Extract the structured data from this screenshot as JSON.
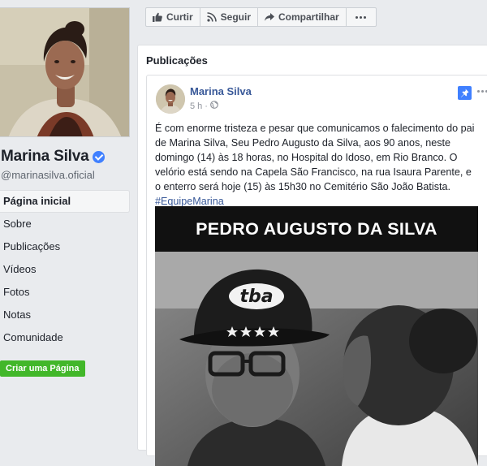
{
  "profile": {
    "name": "Marina Silva",
    "handle": "@marinasilva.oficial"
  },
  "nav": {
    "items": [
      {
        "label": "Página inicial",
        "active": true
      },
      {
        "label": "Sobre"
      },
      {
        "label": "Publicações"
      },
      {
        "label": "Vídeos"
      },
      {
        "label": "Fotos"
      },
      {
        "label": "Notas"
      },
      {
        "label": "Comunidade"
      }
    ],
    "create_page": "Criar uma Página"
  },
  "actions": {
    "like": "Curtir",
    "follow": "Seguir",
    "share": "Compartilhar"
  },
  "posts": {
    "section_title": "Publicações",
    "post": {
      "author": "Marina Silva",
      "time": "5 h",
      "separator": "·",
      "text": "É com enorme tristeza e pesar que comunicamos o falecimento do pai de Marina Silva, Seu Pedro Augusto da Silva, aos 90 anos, neste domingo (14) às 18 horas, no Hospital do Idoso, em Rio Branco. O velório está sendo na Capela São Francisco, na rua Isaura Parente, e o enterro será hoje (15) às 15h30 no Cemitério São João Batista.",
      "hashtag": "#EquipeMarina",
      "image_banner": "PEDRO AUGUSTO DA SILVA",
      "cap_text": "tba"
    }
  },
  "colors": {
    "link": "#385898",
    "verified": "#4080ff",
    "create_button": "#42b72a",
    "background": "#e9ebee"
  }
}
